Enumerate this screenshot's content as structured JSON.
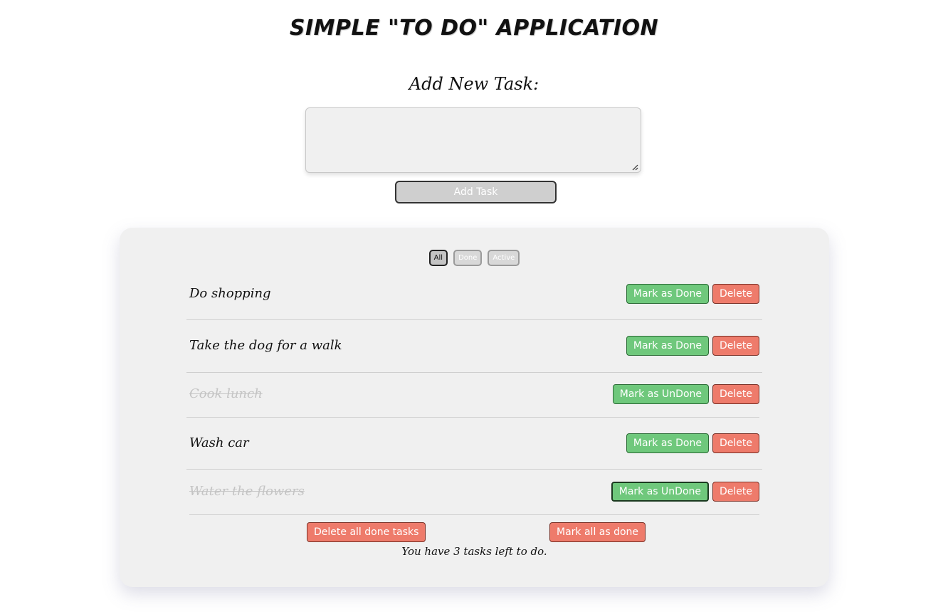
{
  "app": {
    "title": "SIMPLE \"TO DO\" APPLICATION"
  },
  "add_task": {
    "label": "Add New Task:",
    "input_value": "",
    "button_label": "Add Task"
  },
  "filters": [
    {
      "label": "All",
      "active": true
    },
    {
      "label": "Done",
      "active": false
    },
    {
      "label": "Active",
      "active": false
    }
  ],
  "tasks": [
    {
      "text": "Do shopping",
      "done": false,
      "toggle_label": "Mark as Done",
      "delete_label": "Delete"
    },
    {
      "text": "Take the dog for a walk",
      "done": false,
      "toggle_label": "Mark as Done",
      "delete_label": "Delete"
    },
    {
      "text": "Cook lunch",
      "done": true,
      "toggle_label": "Mark as UnDone",
      "delete_label": "Delete"
    },
    {
      "text": "Wash car",
      "done": false,
      "toggle_label": "Mark as Done",
      "delete_label": "Delete"
    },
    {
      "text": "Water the flowers",
      "done": true,
      "toggle_label": "Mark as UnDone",
      "delete_label": "Delete"
    }
  ],
  "footer": {
    "delete_done_label": "Delete all done tasks",
    "mark_all_label": "Mark all as done",
    "status_text": "You have 3 tasks left to do."
  },
  "colors": {
    "done_button": "#6fc87c",
    "delete_button": "#ee7b6b",
    "card_background": "#f0f0f0",
    "completed_text": "#c4c4c4"
  }
}
